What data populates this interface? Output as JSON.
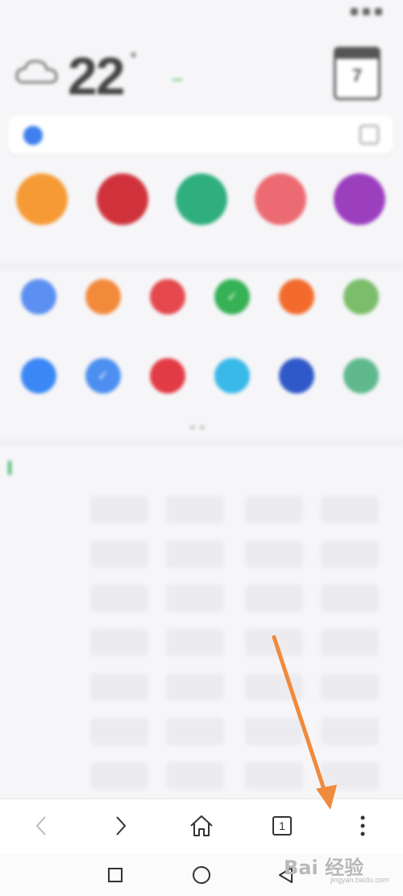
{
  "status_bar": {
    "time": "",
    "indicators": ""
  },
  "weather": {
    "temperature": "22",
    "degree_symbol": "°",
    "condition": "",
    "range": "",
    "aqi": "",
    "calendar_day": "7"
  },
  "search": {
    "placeholder": ""
  },
  "big_apps": [
    {
      "label": "",
      "color": "#f59a35",
      "icon": "app-icon"
    },
    {
      "label": "",
      "color": "#d0323b",
      "icon": "app-icon"
    },
    {
      "label": "",
      "color": "#2fae7e",
      "icon": "game-controller-icon"
    },
    {
      "label": "",
      "color": "#ec6b72",
      "icon": "app-icon"
    },
    {
      "label": "",
      "color": "#9b3fbf",
      "icon": "app-icon"
    }
  ],
  "grid_apps": [
    {
      "label": "",
      "color": "#5b8ff0"
    },
    {
      "label": "",
      "color": "#f28a3c"
    },
    {
      "label": "",
      "color": "#e5484d"
    },
    {
      "label": "",
      "color": "#36b155"
    },
    {
      "label": "",
      "color": "#f36b2c"
    },
    {
      "label": "",
      "color": "#7bbd6a"
    },
    {
      "label": "",
      "color": "#3a87f5"
    },
    {
      "label": "",
      "color": "#4d8ff0"
    },
    {
      "label": "",
      "color": "#e23b45"
    },
    {
      "label": "",
      "color": "#38b9e8"
    },
    {
      "label": "",
      "color": "#2f59c8"
    },
    {
      "label": "",
      "color": "#5fb98d"
    }
  ],
  "sites": {
    "heading": "",
    "rows": [
      {
        "category": "",
        "items": [
          "",
          "",
          "",
          ""
        ]
      },
      {
        "category": "",
        "items": [
          "",
          "",
          "",
          ""
        ]
      },
      {
        "category": "",
        "items": [
          "",
          "",
          "",
          ""
        ]
      },
      {
        "category": "",
        "items": [
          "",
          "",
          "",
          ""
        ]
      },
      {
        "category": "",
        "items": [
          "",
          "",
          "",
          ""
        ]
      },
      {
        "category": "",
        "items": [
          "",
          "",
          "",
          ""
        ]
      },
      {
        "category": "",
        "items": [
          "",
          "",
          "",
          ""
        ]
      }
    ]
  },
  "toolbar": {
    "tab_count": "1"
  },
  "watermark": {
    "text": "Bai 经验",
    "sub": "jingyan.baidu.com"
  },
  "colors": {
    "accent_arrow": "#f08a3c",
    "search_logo": "#3f7ff0",
    "aqi_badge": "#52c26a"
  }
}
